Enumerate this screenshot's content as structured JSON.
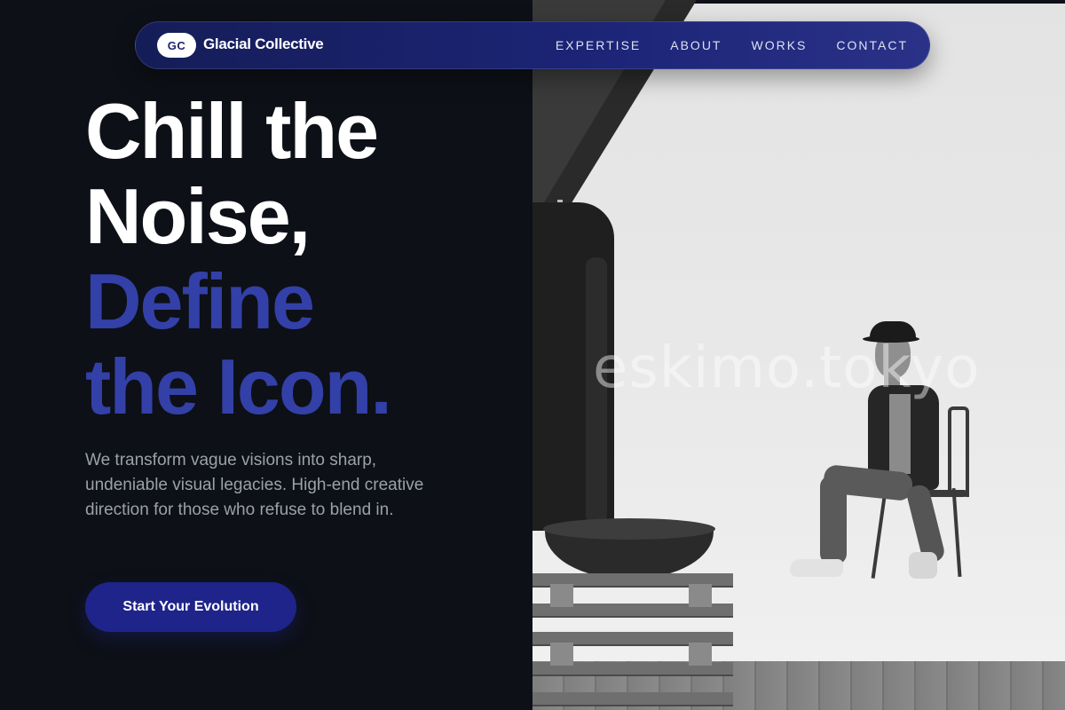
{
  "brand": {
    "logo_initials": "GC",
    "name": "Glacial Collective"
  },
  "nav": {
    "links": [
      {
        "label": "EXPERTISE"
      },
      {
        "label": "ABOUT"
      },
      {
        "label": "WORKS"
      },
      {
        "label": "CONTACT"
      }
    ]
  },
  "hero": {
    "headline_line1": "Chill the",
    "headline_line2": "Noise,",
    "headline_accent_line1": "Define",
    "headline_accent_line2": "the Icon.",
    "description": "We transform vague visions into sharp, undeniable visual legacies. High-end creative direction for those who refuse to blend in.",
    "cta_label": "Start Your Evolution"
  },
  "image": {
    "watermark": "eskimo.tokyo"
  },
  "colors": {
    "background": "#0d1016",
    "accent": "#3340a8",
    "button": "#1f248a",
    "nav": "#1c2577"
  }
}
